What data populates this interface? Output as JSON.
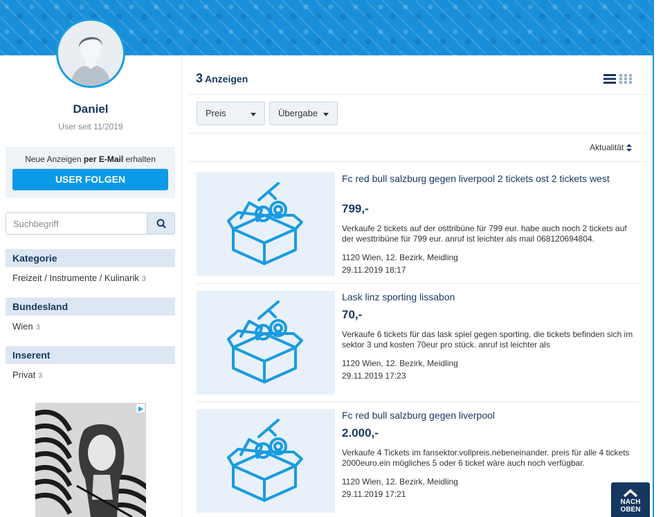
{
  "profile": {
    "name": "Daniel",
    "member_since": "User seit 11/2019",
    "follow_text_pre": "Neue Anzeigen ",
    "follow_text_bold": "per E-Mail",
    "follow_text_post": " erhalten",
    "follow_button": "USER FOLGEN"
  },
  "search": {
    "placeholder": "Suchbegriff"
  },
  "filters": [
    {
      "heading": "Kategorie",
      "item": "Freizeit / Instrumente / Kulinarik",
      "count": "3"
    },
    {
      "heading": "Bundesland",
      "item": "Wien",
      "count": "3"
    },
    {
      "heading": "Inserent",
      "item": "Privat",
      "count": "3"
    }
  ],
  "results": {
    "count": "3",
    "label": "Anzeigen"
  },
  "toolbar": {
    "price_label": "Preis",
    "handover_label": "Übergabe",
    "sort_label": "Aktualität"
  },
  "listings": [
    {
      "title": "Fc red bull salzburg gegen liverpool 2 tickets ost 2 tickets west",
      "price": "799,-",
      "description": "Verkaufe 2 tickets auf der osttribüne für 799 eur. habe auch noch 2 tickets auf der westtribüne  für 799 eur. anruf ist leichter als mail 068120694804.",
      "location": "1120 Wien, 12. Bezirk, Meidling",
      "date": "29.11.2019 18:17"
    },
    {
      "title": "Lask linz sporting lissabon",
      "price": "70,-",
      "description": "Verkaufe 6 tickets für das lask spiel gegen sporting. die tickets befinden sich im sektor 3 und kosten 70eur pro stück. anruf ist leichter als",
      "location": "1120 Wien, 12. Bezirk, Meidling",
      "date": "29.11.2019 17:23"
    },
    {
      "title": "Fc red bull salzburg gegen liverpool",
      "price": "2.000,-",
      "description": "Verkaufe 4 Tickets im fansektor.vollpreis.nebeneinander. preis für alle 4 tickets 2000euro.ein mögliches 5 oder 6 ticket wäre auch noch verfügbar.",
      "location": "1120 Wien, 12. Bezirk, Meidling",
      "date": "29.11.2019 17:21"
    }
  ],
  "back_to_top": {
    "line1": "NACH",
    "line2": "OBEN"
  },
  "icons": {
    "avatar": "user-avatar-icon",
    "search": "search-icon",
    "view_list": "list-view-icon",
    "view_grid": "grid-view-icon",
    "sort": "sort-updown-icon",
    "placeholder": "box-placeholder-icon",
    "top": "chevron-up-icon"
  },
  "colors": {
    "brand_blue": "#1a8fd9",
    "navy": "#16375f",
    "button_blue": "#0a9ae6"
  }
}
